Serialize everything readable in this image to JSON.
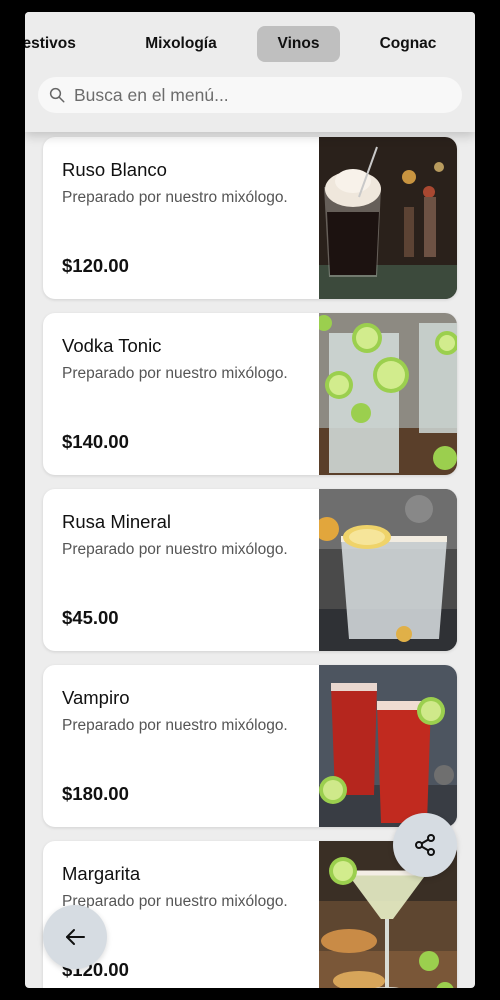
{
  "tabs": [
    {
      "label": "gestivos",
      "active": false
    },
    {
      "label": "Mixología",
      "active": false
    },
    {
      "label": "Vinos",
      "active": true
    },
    {
      "label": "Cognac",
      "active": false
    }
  ],
  "search": {
    "placeholder": "Busca en el menú..."
  },
  "items": [
    {
      "name": "Ruso Blanco",
      "description": "Preparado por nuestro mixólogo.",
      "price": "$120.00",
      "image": "white-russian-photo"
    },
    {
      "name": "Vodka Tonic",
      "description": "Preparado por nuestro mixólogo.",
      "price": "$140.00",
      "image": "vodka-tonic-photo"
    },
    {
      "name": "Rusa Mineral",
      "description": "Preparado por nuestro mixólogo.",
      "price": "$45.00",
      "image": "rusa-mineral-photo"
    },
    {
      "name": "Vampiro",
      "description": "Preparado por nuestro mixólogo.",
      "price": "$180.00",
      "image": "vampiro-photo"
    },
    {
      "name": "Margarita",
      "description": "Preparado por nuestro mixólogo.",
      "price": "$120.00",
      "image": "margarita-photo"
    }
  ],
  "buttons": {
    "share_icon": "share-icon",
    "back_icon": "arrow-left-icon"
  },
  "colors": {
    "active_tab": "#bfbfbf",
    "fab": "#d6dce2",
    "page_background": "#ededed"
  }
}
